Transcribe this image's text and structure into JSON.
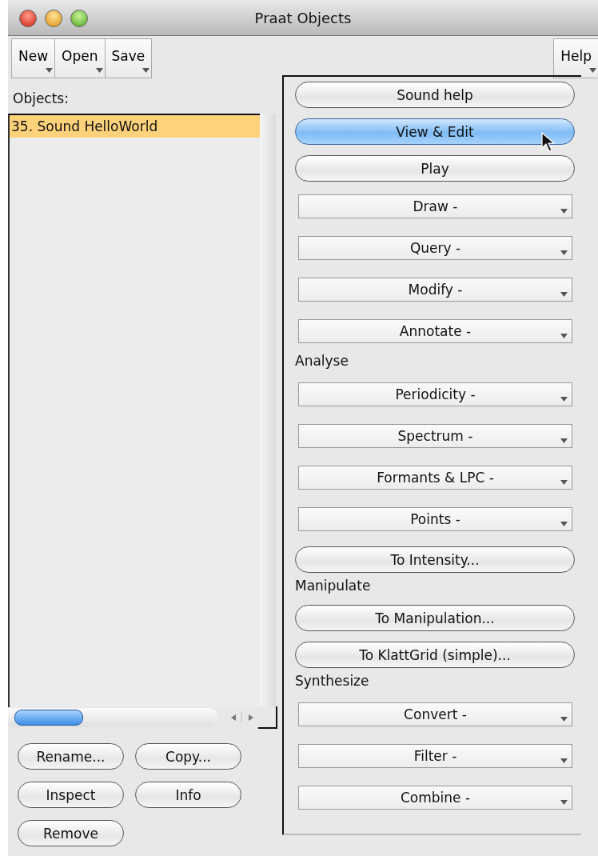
{
  "window": {
    "title": "Praat Objects"
  },
  "toolbar": {
    "left": [
      "New",
      "Open",
      "Save"
    ],
    "right": [
      "Help"
    ]
  },
  "objects": {
    "label": "Objects:",
    "items": [
      {
        "text": "35. Sound HelloWorld",
        "selected": true
      }
    ],
    "buttons": [
      [
        "Rename...",
        "Copy..."
      ],
      [
        "Inspect",
        "Info"
      ],
      [
        "Remove"
      ]
    ]
  },
  "actions": [
    {
      "kind": "pill",
      "label": "Sound help",
      "selected": false
    },
    {
      "kind": "pill",
      "label": "View & Edit",
      "selected": true
    },
    {
      "kind": "pill",
      "label": "Play",
      "selected": false
    },
    {
      "kind": "menu",
      "label": "Draw -"
    },
    {
      "kind": "menu",
      "label": "Query -"
    },
    {
      "kind": "menu",
      "label": "Modify -"
    },
    {
      "kind": "menu",
      "label": "Annotate -"
    },
    {
      "kind": "heading",
      "label": "Analyse"
    },
    {
      "kind": "menu",
      "label": "Periodicity -"
    },
    {
      "kind": "menu",
      "label": "Spectrum -"
    },
    {
      "kind": "menu",
      "label": "Formants & LPC -"
    },
    {
      "kind": "menu",
      "label": "Points -"
    },
    {
      "kind": "pill",
      "label": "To Intensity...",
      "selected": false
    },
    {
      "kind": "heading",
      "label": "Manipulate"
    },
    {
      "kind": "pill",
      "label": "To Manipulation...",
      "selected": false
    },
    {
      "kind": "pill",
      "label": "To KlattGrid (simple)...",
      "selected": false
    },
    {
      "kind": "heading",
      "label": "Synthesize"
    },
    {
      "kind": "menu",
      "label": "Convert -"
    },
    {
      "kind": "menu",
      "label": "Filter -"
    },
    {
      "kind": "menu",
      "label": "Combine -"
    }
  ]
}
